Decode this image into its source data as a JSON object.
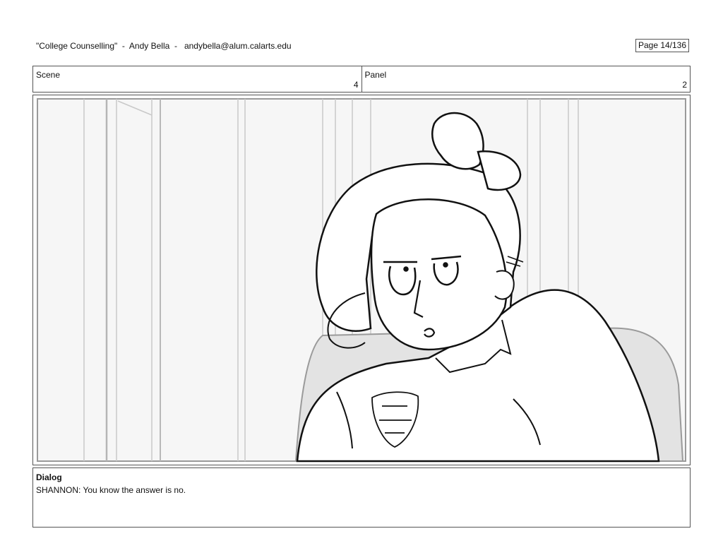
{
  "header": {
    "title": "\"College Counselling\"  -  Andy Bella  -   andybella@alum.calarts.edu",
    "page_label": "Page  14/136"
  },
  "scene": {
    "label": "Scene",
    "value": "4"
  },
  "panel": {
    "label": "Panel",
    "value": "2"
  },
  "dialog": {
    "heading": "Dialog",
    "text": "SHANNON: You know the answer is no."
  }
}
